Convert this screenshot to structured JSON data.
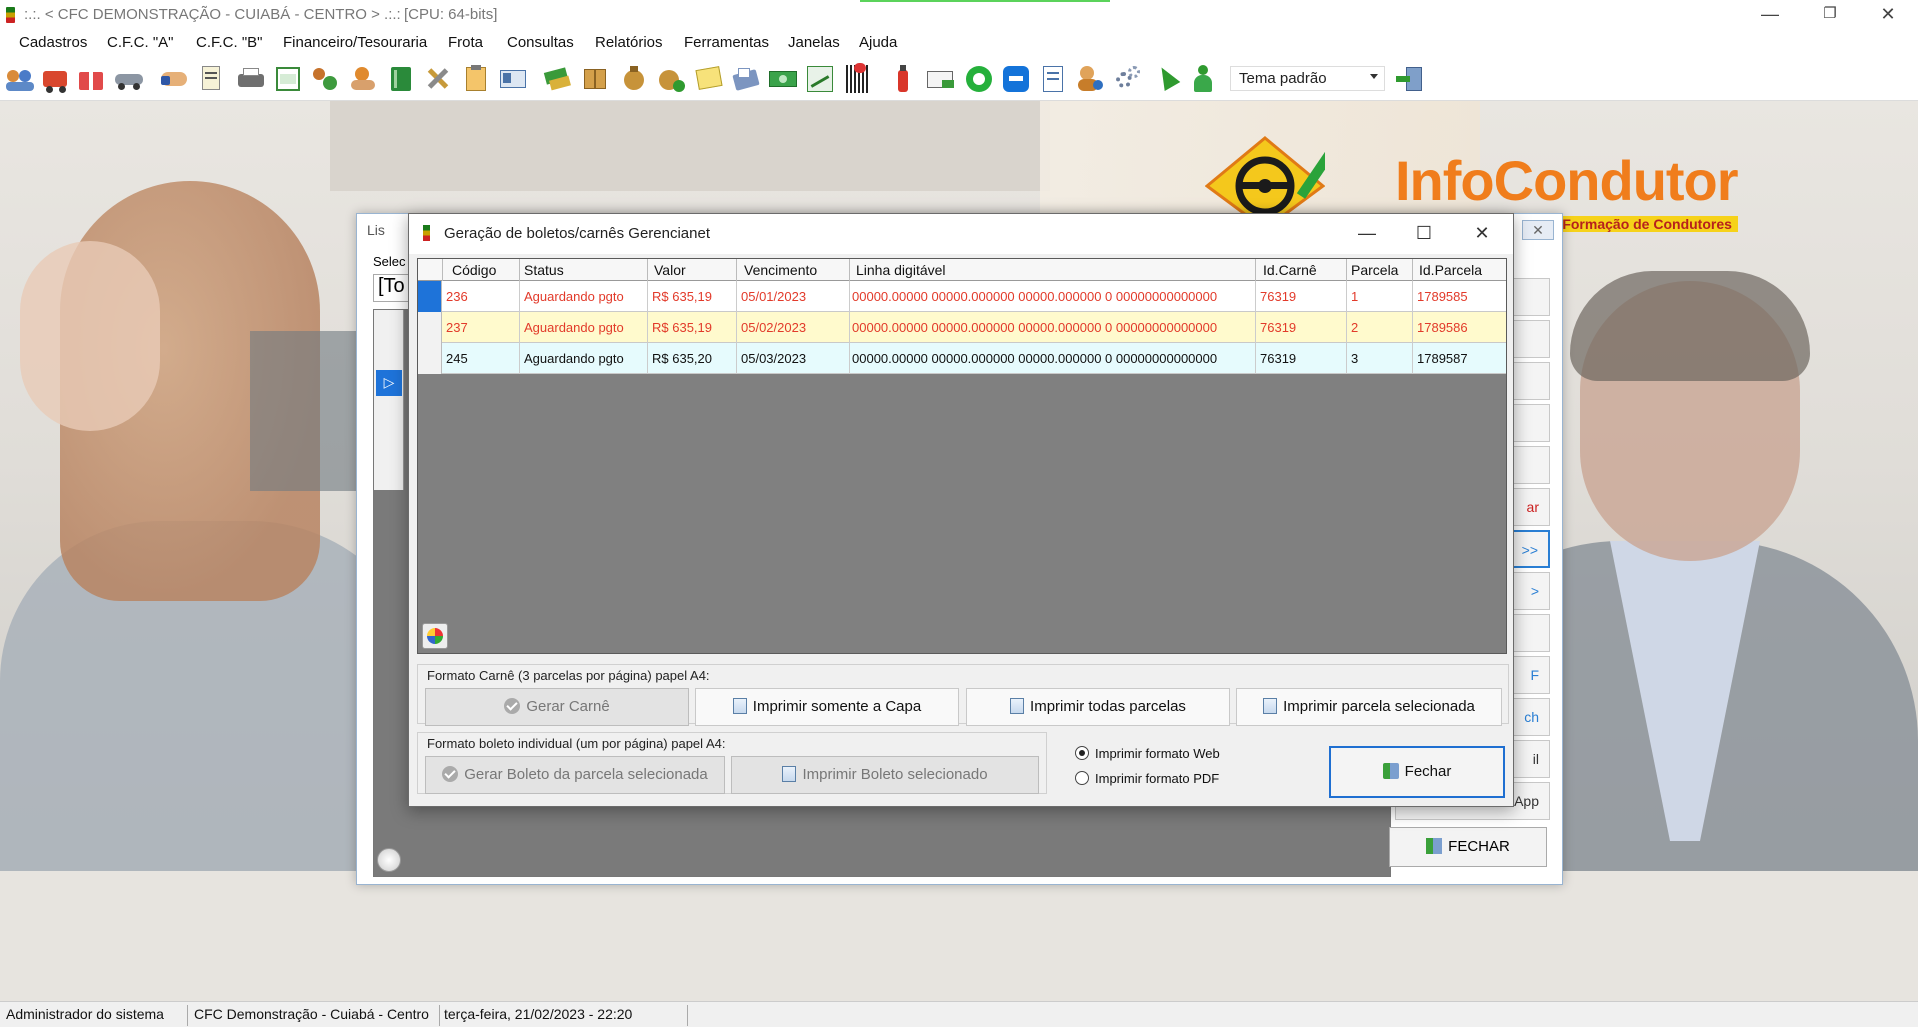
{
  "window": {
    "title": ":.:. < CFC DEMONSTRAÇÃO - CUIABÁ - CENTRO > .:.:",
    "cpu": "[CPU: 64-bits]",
    "minimize": "—",
    "restore": "❐",
    "close": "✕"
  },
  "menu": [
    "Cadastros",
    "C.F.C. \"A\"",
    "C.F.C. \"B\"",
    "Financeiro/Tesouraria",
    "Frota",
    "Consultas",
    "Relatórios",
    "Ferramentas",
    "Janelas",
    "Ajuda"
  ],
  "toolbar": {
    "theme_value": "Tema padrão"
  },
  "logo": {
    "brand_info": "Info",
    "brand_condutor": "Condutor",
    "tagline": "ntro de Formação de Condutores"
  },
  "back_window": {
    "title": "Lis",
    "select_label": "Selec",
    "combo_value": "[To",
    "side_buttons": [
      "",
      "",
      "",
      "",
      "",
      "ar",
      ">>",
      ">",
      "",
      "F",
      "ch",
      "il",
      "WhatsApp"
    ],
    "fechar": "FECHAR"
  },
  "dialog": {
    "title": "Geração de boletos/carnês Gerencianet",
    "minimize": "—",
    "maximize": "☐",
    "close": "✕",
    "columns": [
      "Código",
      "Status",
      "Valor",
      "Vencimento",
      "Linha digitável",
      "Id.Carnê",
      "Parcela",
      "Id.Parcela"
    ],
    "rows": [
      {
        "codigo": "236",
        "status": "Aguardando pgto",
        "valor": "R$ 635,19",
        "vencimento": "05/01/2023",
        "linha": "00000.00000 00000.000000 00000.000000 0 00000000000000",
        "id_carne": "76319",
        "parcela": "1",
        "id_parcela": "1789585"
      },
      {
        "codigo": "237",
        "status": "Aguardando pgto",
        "valor": "R$ 635,19",
        "vencimento": "05/02/2023",
        "linha": "00000.00000 00000.000000 00000.000000 0 00000000000000",
        "id_carne": "76319",
        "parcela": "2",
        "id_parcela": "1789586"
      },
      {
        "codigo": "245",
        "status": "Aguardando pgto",
        "valor": "R$ 635,20",
        "vencimento": "05/03/2023",
        "linha": "00000.00000 00000.000000 00000.000000 0 00000000000000",
        "id_carne": "76319",
        "parcela": "3",
        "id_parcela": "1789587"
      }
    ],
    "group_carne_label": "Formato Carnê (3 parcelas por página) papel A4:",
    "btn_gerar_carne": "Gerar Carnê",
    "btn_imprimir_capa": "Imprimir somente a Capa",
    "btn_imprimir_todas": "Imprimir todas parcelas",
    "btn_imprimir_parcela": "Imprimir parcela selecionada",
    "group_boleto_label": "Formato boleto individual (um por página) papel A4:",
    "btn_gerar_boleto": "Gerar Boleto da parcela selecionada",
    "btn_imprimir_boleto": "Imprimir Boleto selecionado",
    "radio_web": "Imprimir formato Web",
    "radio_pdf": "Imprimir formato PDF",
    "btn_fechar": "Fechar"
  },
  "status": {
    "user": "Administrador do sistema",
    "company": "CFC Demonstração - Cuiabá - Centro",
    "datetime": "terça-feira, 21/02/2023 - 22:20"
  },
  "colors": {
    "row_red_text": "#e23a2a",
    "row_highlight": "#fffacd",
    "row_cyan": "#e6fbfd",
    "selection_blue": "#1e73d9",
    "brand_orange": "#f07d1c"
  }
}
